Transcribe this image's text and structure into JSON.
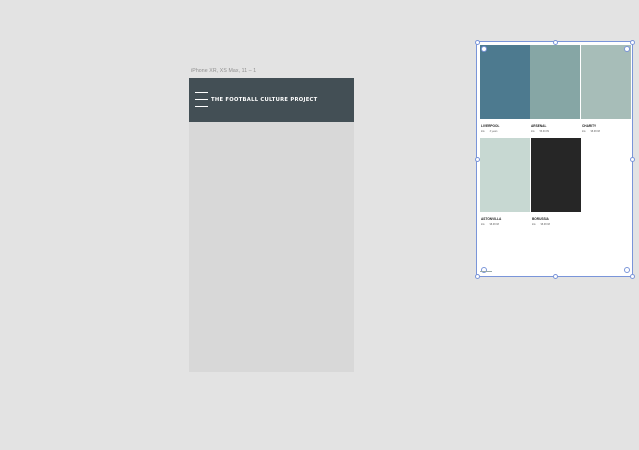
{
  "artboard": {
    "label": "iPhone XR, XS Max, 11 – 1",
    "header": {
      "title": "THE FOOTBALL CULTURE PROJECT",
      "menu_icon": "hamburger-icon",
      "bg_color": "#434f55"
    },
    "body_color": "#d8d8d8"
  },
  "component": {
    "tiles": [
      {
        "name": "LIVERPOOL",
        "meta_left": "kits",
        "meta_right": "3 years",
        "color": "#4d7a8f"
      },
      {
        "name": "ARSENAL",
        "meta_left": "kits",
        "meta_right": "56.90.89",
        "color": "#86a6a5"
      },
      {
        "name": "CHARITY",
        "meta_left": "kits",
        "meta_right": "98.98.98",
        "color": "#a7bdb8"
      },
      {
        "name": "ASTONVILLA",
        "meta_left": "kits",
        "meta_right": "98.98.98",
        "color": "#c7d8d2"
      },
      {
        "name": "BORUSSIA",
        "meta_left": "kits",
        "meta_right": "98.98.98",
        "color": "#262626"
      }
    ],
    "selection_color": "#7a95d9"
  }
}
